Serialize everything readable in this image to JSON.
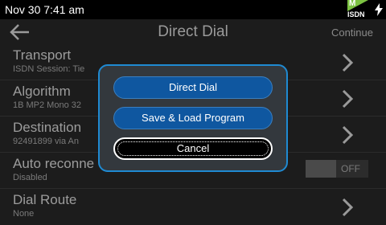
{
  "status_bar": {
    "time": "Nov 30 7:41 am",
    "network_badge_letter": "M",
    "network_badge_label": "ISDN",
    "badge_color": "#7cc242"
  },
  "header": {
    "title": "Direct Dial",
    "continue_label": "Continue"
  },
  "rows": [
    {
      "title": "Transport",
      "subtitle": "ISDN Session: Tie",
      "control": "chevron"
    },
    {
      "title": "Algorithm",
      "subtitle": "1B MP2 Mono 32",
      "control": "chevron"
    },
    {
      "title": "Destination",
      "subtitle": "92491899 via An",
      "control": "chevron"
    },
    {
      "title": "Auto reconne",
      "subtitle": "Disabled",
      "control": "toggle",
      "toggle_label": "OFF",
      "toggle_on": false
    },
    {
      "title": "Dial Route",
      "subtitle": "None",
      "control": "chevron"
    }
  ],
  "dialog": {
    "buttons": [
      "Direct Dial",
      "Save & Load Program",
      "Cancel"
    ],
    "border_color": "#1f8ad2",
    "primary_color": "#0f57a0"
  }
}
